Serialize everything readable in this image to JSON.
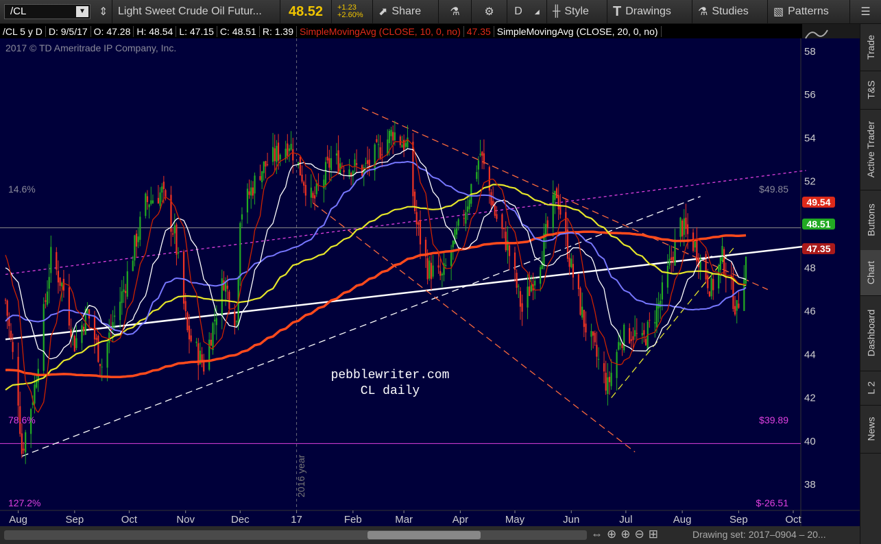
{
  "toolbar": {
    "symbol": "/CL",
    "description": "Light Sweet Crude Oil Futur...",
    "last": "48.52",
    "change": "+1.23",
    "change_pct": "+2.60%",
    "share": "Share",
    "aggregation": "D",
    "style": "Style",
    "drawings": "Drawings",
    "studies": "Studies",
    "patterns": "Patterns"
  },
  "header": {
    "symbol_period": "/CL 5 y D",
    "date": "D: 9/5/17",
    "open": "O: 47.28",
    "high": "H: 48.54",
    "low": "L: 47.15",
    "close": "C: 48.51",
    "range": "R: 1.39",
    "sma10": "SimpleMovingAvg (CLOSE, 10, 0, no)",
    "sma10_value": "47.35",
    "sma20": "SimpleMovingAvg (CLOSE, 20, 0, no)"
  },
  "chart": {
    "copyright": "2017 © TD Ameritrade IP Company, Inc.",
    "watermark_line1": "pebblewriter.com",
    "watermark_line2": "CL daily",
    "year_marker": "2016 year",
    "fib_top_pct": "14.6%",
    "fib_top_price": "$49.85",
    "fib_mid_pct": "78.6%",
    "fib_mid_price": "$39.89",
    "fib_bot_pct": "127.2%",
    "fib_bot_price": "$-26.51",
    "badge_red_top": "49.54",
    "badge_green": "48.51",
    "badge_red_bottom": "47.35",
    "colors": {
      "background": "#00003a",
      "sma10": "#cc2200",
      "sma20": "#ffffff",
      "sma50": "#7777ff",
      "sma100": "#e6e62a",
      "sma200": "#ff4a1c",
      "fib_pink": "#e040e0",
      "up_candle": "#22aa22",
      "down_candle": "#ee3322"
    }
  },
  "chart_data": {
    "type": "candlestick",
    "title": "/CL 5 y D",
    "x_range": [
      "2016-07-25",
      "2017-09-05"
    ],
    "ylim": [
      36.8,
      58.6
    ],
    "yticks": [
      38,
      40,
      42,
      44,
      46,
      48,
      50,
      52,
      54,
      56,
      58
    ],
    "xticks": [
      "Aug",
      "Sep",
      "Oct",
      "Nov",
      "Dec",
      "17",
      "Feb",
      "Mar",
      "Apr",
      "May",
      "Jun",
      "Jul",
      "Aug",
      "Sep",
      "Oct"
    ],
    "pivots": [
      {
        "d": "2016-07-25",
        "p": 46.5
      },
      {
        "d": "2016-08-01",
        "p": 42.0
      },
      {
        "d": "2016-08-03",
        "p": 39.5
      },
      {
        "d": "2016-08-10",
        "p": 42.5
      },
      {
        "d": "2016-08-19",
        "p": 48.5
      },
      {
        "d": "2016-08-26",
        "p": 47.0
      },
      {
        "d": "2016-09-01",
        "p": 44.5
      },
      {
        "d": "2016-09-08",
        "p": 46.0
      },
      {
        "d": "2016-09-16",
        "p": 43.5
      },
      {
        "d": "2016-09-22",
        "p": 45.5
      },
      {
        "d": "2016-09-28",
        "p": 47.0
      },
      {
        "d": "2016-10-10",
        "p": 51.0
      },
      {
        "d": "2016-10-19",
        "p": 51.5
      },
      {
        "d": "2016-10-26",
        "p": 49.5
      },
      {
        "d": "2016-11-02",
        "p": 45.0
      },
      {
        "d": "2016-11-11",
        "p": 43.5
      },
      {
        "d": "2016-11-22",
        "p": 47.5
      },
      {
        "d": "2016-11-29",
        "p": 45.5
      },
      {
        "d": "2016-12-01",
        "p": 50.5
      },
      {
        "d": "2016-12-12",
        "p": 52.5
      },
      {
        "d": "2016-12-28",
        "p": 53.8
      },
      {
        "d": "2017-01-03",
        "p": 52.5
      },
      {
        "d": "2017-01-10",
        "p": 51.0
      },
      {
        "d": "2017-01-20",
        "p": 53.0
      },
      {
        "d": "2017-02-07",
        "p": 52.5
      },
      {
        "d": "2017-02-23",
        "p": 54.3
      },
      {
        "d": "2017-03-03",
        "p": 53.5
      },
      {
        "d": "2017-03-08",
        "p": 50.0
      },
      {
        "d": "2017-03-14",
        "p": 48.0
      },
      {
        "d": "2017-03-22",
        "p": 47.5
      },
      {
        "d": "2017-04-03",
        "p": 50.5
      },
      {
        "d": "2017-04-12",
        "p": 53.3
      },
      {
        "d": "2017-04-20",
        "p": 50.5
      },
      {
        "d": "2017-04-27",
        "p": 49.0
      },
      {
        "d": "2017-05-05",
        "p": 46.0
      },
      {
        "d": "2017-05-15",
        "p": 48.5
      },
      {
        "d": "2017-05-24",
        "p": 51.5
      },
      {
        "d": "2017-06-01",
        "p": 48.0
      },
      {
        "d": "2017-06-08",
        "p": 45.5
      },
      {
        "d": "2017-06-21",
        "p": 42.5
      },
      {
        "d": "2017-06-28",
        "p": 44.8
      },
      {
        "d": "2017-07-05",
        "p": 45.0
      },
      {
        "d": "2017-07-10",
        "p": 44.5
      },
      {
        "d": "2017-07-20",
        "p": 46.5
      },
      {
        "d": "2017-07-31",
        "p": 50.0
      },
      {
        "d": "2017-08-08",
        "p": 49.0
      },
      {
        "d": "2017-08-17",
        "p": 47.0
      },
      {
        "d": "2017-08-23",
        "p": 48.5
      },
      {
        "d": "2017-08-31",
        "p": 46.0
      },
      {
        "d": "2017-09-05",
        "p": 48.51
      }
    ],
    "series": [
      {
        "name": "SimpleMovingAvg (CLOSE, 10, 0, no)",
        "period": 10,
        "color": "#cc2200"
      },
      {
        "name": "SimpleMovingAvg (CLOSE, 20, 0, no)",
        "period": 20,
        "color": "#ffffff"
      },
      {
        "period": 50,
        "color": "#7777ff"
      },
      {
        "period": 100,
        "color": "#e6e62a"
      },
      {
        "period": 200,
        "color": "#ff4a1c"
      }
    ],
    "trendlines": [
      {
        "color": "#ffffff",
        "style": "solid",
        "from": [
          "2016-07-25",
          44.7
        ],
        "to": [
          "2017-10-08",
          49.0
        ]
      },
      {
        "color": "#ffffff",
        "style": "dashed",
        "from": [
          "2016-08-03",
          39.3
        ],
        "to": [
          "2017-08-11",
          51.3
        ]
      },
      {
        "color": "#ff6a3c",
        "style": "dashed",
        "from": [
          "2017-02-06",
          55.4
        ],
        "to": [
          "2017-09-17",
          47.0
        ]
      },
      {
        "color": "#ff6a3c",
        "style": "dashed",
        "from": [
          "2017-01-10",
          51.0
        ],
        "to": [
          "2017-07-06",
          39.5
        ]
      },
      {
        "color": "#e040e0",
        "style": "dotted",
        "from": [
          "2016-07-25",
          47.7
        ],
        "to": [
          "2017-10-08",
          52.5
        ]
      },
      {
        "color": "#e6e62a",
        "style": "dashed",
        "from": [
          "2017-06-23",
          42.0
        ],
        "to": [
          "2017-08-30",
          49.0
        ]
      }
    ],
    "fib_levels": [
      {
        "label": "14.6%",
        "price": 49.85,
        "color": "#888888"
      },
      {
        "label": "78.6%",
        "price": 39.89,
        "color": "#e040e0"
      },
      {
        "label": "127.2%",
        "price": -26.51,
        "color": "#e040e0"
      }
    ]
  },
  "sidebar": [
    "Trade",
    "T&S",
    "Active Trader",
    "Buttons",
    "Chart",
    "Dashboard",
    "L 2",
    "News"
  ],
  "bottom": {
    "drawing_set": "Drawing set: 2017–0904 – 20..."
  }
}
